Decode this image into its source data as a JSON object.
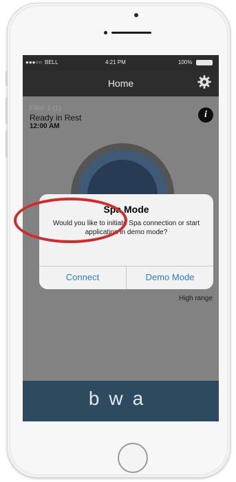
{
  "status_bar": {
    "carrier": "BELL",
    "time": "4:21 PM",
    "battery": "100%"
  },
  "nav": {
    "title": "Home",
    "settings_icon": "gear-icon"
  },
  "spa_status": {
    "line1": "Filter 1 (1)",
    "line2": "Ready in Rest",
    "line3": "12:00 AM",
    "info_icon": "info-icon"
  },
  "heat_range_label": "High range",
  "alert": {
    "title": "Spa Mode",
    "message": "Would you like to initiate Spa connection or start application in demo mode?",
    "connect_label": "Connect",
    "demo_label": "Demo Mode",
    "button_color": "#2f7bd1"
  },
  "brand": {
    "logo_text": "bwa",
    "color": "#2e4a5f"
  },
  "annotation": {
    "highlight_color": "#d12a2a"
  }
}
